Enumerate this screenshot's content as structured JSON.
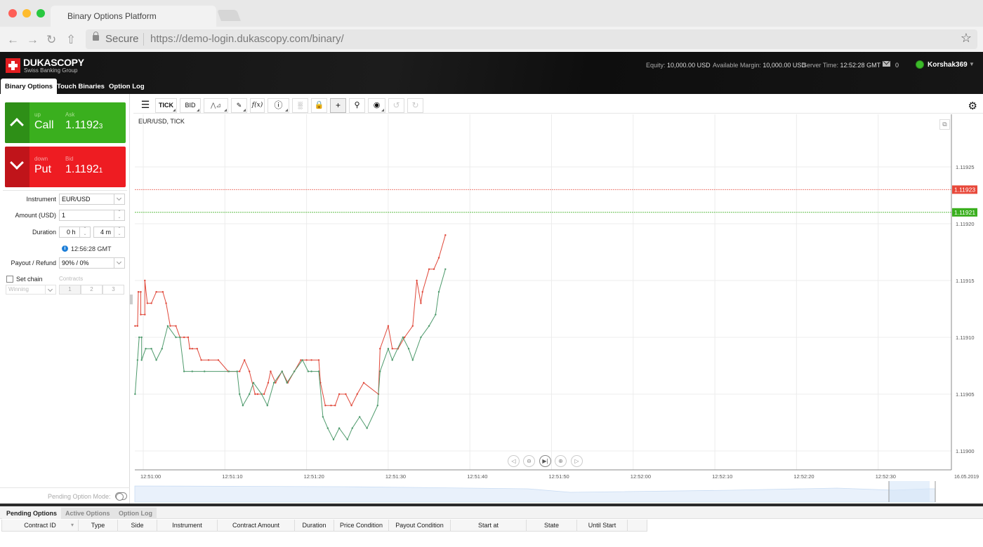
{
  "browser": {
    "tab_title": "Binary Options Platform",
    "secure_label": "Secure",
    "url": "https://demo-login.dukascopy.com/binary/"
  },
  "header": {
    "brand": "DUKASCOPY",
    "brand_sub": "Swiss Banking Group",
    "equity_label": "Equity:",
    "equity_value": "10,000.00 USD",
    "margin_label": "Available Margin:",
    "margin_value": "10,000.00 USD",
    "server_time_label": "Server Time:",
    "server_time_value": "12:52:28 GMT",
    "messages_count": "0",
    "username": "Korshak369",
    "tabs": [
      {
        "label": "Binary Options",
        "active": true
      },
      {
        "label": "Touch Binaries",
        "active": false
      },
      {
        "label": "Option Log",
        "active": false
      }
    ]
  },
  "trade": {
    "call": {
      "dir": "up",
      "side": "Call",
      "price_label": "Ask",
      "price_main": "1.1192",
      "price_pip": "3",
      "color": "#3aaf1e",
      "arrow_bg": "#2e8f17"
    },
    "put": {
      "dir": "down",
      "side": "Put",
      "price_label": "Bid",
      "price_main": "1.1192",
      "price_pip": "1",
      "color": "#ee1c22",
      "arrow_bg": "#c0141a"
    },
    "instrument_label": "Instrument",
    "instrument_value": "EUR/USD",
    "amount_label": "Amount (USD)",
    "amount_value": "1",
    "duration_label": "Duration",
    "duration_hours": "0 h",
    "duration_minutes": "4 m",
    "expiry_time": "12:56:28 GMT",
    "payout_label": "Payout / Refund",
    "payout_value": "90% / 0%",
    "set_chain_label": "Set chain",
    "contracts_label": "Contracts",
    "chain_condition": "Winning",
    "contracts_options": [
      "1",
      "2",
      "3"
    ],
    "pending_mode_label": "Pending Option Mode:"
  },
  "chart_toolbar": {
    "period": "TICK",
    "price_side": "BID",
    "fx_label": "f(x)"
  },
  "chart_data": {
    "type": "line",
    "title": "EUR/USD, TICK",
    "xlabel": "",
    "ylabel": "",
    "date_label": "16.05.2019",
    "x_unit": "seconds after 12:51:00",
    "x_ticks": [
      "12:51:00",
      "12:51:10",
      "12:51:20",
      "12:51:30",
      "12:51:40",
      "12:51:50",
      "12:52:00",
      "12:52:10",
      "12:52:20",
      "12:52:30"
    ],
    "y_ticks": [
      "1.11900",
      "1.11905",
      "1.11910",
      "1.11915",
      "1.11920",
      "1.11925"
    ],
    "ylim": [
      1.118985,
      1.11927
    ],
    "xlim": [
      -1,
      37
    ],
    "grid": true,
    "current_ask": {
      "value": "1.11923",
      "color": "#e8483a"
    },
    "current_bid": {
      "value": "1.11921",
      "color": "#3aaf1e"
    },
    "series": [
      {
        "name": "Ask",
        "color": "#e0483a",
        "points": [
          [
            -1,
            1.11911
          ],
          [
            -0.7,
            1.11911
          ],
          [
            -0.6,
            1.11914
          ],
          [
            -0.3,
            1.11914
          ],
          [
            -0.3,
            1.11912
          ],
          [
            0.2,
            1.11912
          ],
          [
            0.2,
            1.11915
          ],
          [
            0.5,
            1.11913
          ],
          [
            1,
            1.11913
          ],
          [
            1.6,
            1.11914
          ],
          [
            2.4,
            1.11914
          ],
          [
            2.8,
            1.11913
          ],
          [
            3.3,
            1.11911
          ],
          [
            4.0,
            1.11911
          ],
          [
            4.5,
            1.1191
          ],
          [
            5.0,
            1.1191
          ],
          [
            5.5,
            1.1191
          ],
          [
            5.7,
            1.11909
          ],
          [
            6.0,
            1.11909
          ],
          [
            6.6,
            1.11909
          ],
          [
            7.1,
            1.11908
          ],
          [
            8.0,
            1.11908
          ],
          [
            9.2,
            1.11908
          ],
          [
            10.4,
            1.11907
          ],
          [
            11.8,
            1.11907
          ],
          [
            12.4,
            1.11908
          ],
          [
            13.0,
            1.11907
          ],
          [
            13.7,
            1.11905
          ],
          [
            14.0,
            1.11905
          ],
          [
            14.8,
            1.11905
          ],
          [
            15.3,
            1.11906
          ],
          [
            15.6,
            1.11907
          ],
          [
            16.2,
            1.11906
          ],
          [
            17.0,
            1.11907
          ],
          [
            17.7,
            1.11906
          ],
          [
            18.5,
            1.11907
          ],
          [
            19.3,
            1.11908
          ],
          [
            20.0,
            1.11908
          ],
          [
            20.6,
            1.11908
          ],
          [
            21.5,
            1.11908
          ],
          [
            21.7,
            1.11906
          ],
          [
            22.3,
            1.11904
          ],
          [
            23.0,
            1.11904
          ],
          [
            23.5,
            1.11904
          ],
          [
            24.0,
            1.11905
          ],
          [
            24.8,
            1.11905
          ],
          [
            25.5,
            1.11904
          ],
          [
            26.2,
            1.11905
          ],
          [
            27.0,
            1.11906
          ],
          [
            28.8,
            1.11905
          ],
          [
            29.0,
            1.11909
          ],
          [
            30.0,
            1.11911
          ],
          [
            30.5,
            1.11909
          ],
          [
            31.2,
            1.11909
          ],
          [
            32.0,
            1.1191
          ],
          [
            33.0,
            1.11911
          ],
          [
            33.5,
            1.11915
          ],
          [
            34.0,
            1.11913
          ],
          [
            34.2,
            1.11914
          ],
          [
            35.0,
            1.11916
          ],
          [
            35.6,
            1.11916
          ],
          [
            36.2,
            1.11917
          ],
          [
            37.0,
            1.11919
          ]
        ]
      },
      {
        "name": "Bid",
        "color": "#4e9a6c",
        "points": [
          [
            -1,
            1.11905
          ],
          [
            -0.7,
            1.11908
          ],
          [
            -0.5,
            1.1191
          ],
          [
            -0.2,
            1.1191
          ],
          [
            -0.2,
            1.11908
          ],
          [
            0.3,
            1.11909
          ],
          [
            1.0,
            1.11909
          ],
          [
            1.6,
            1.11908
          ],
          [
            2.3,
            1.11909
          ],
          [
            3.0,
            1.11911
          ],
          [
            4.0,
            1.1191
          ],
          [
            4.5,
            1.1191
          ],
          [
            5.0,
            1.11907
          ],
          [
            6.0,
            1.11907
          ],
          [
            7.5,
            1.11907
          ],
          [
            10.5,
            1.11907
          ],
          [
            11.5,
            1.11907
          ],
          [
            11.8,
            1.11905
          ],
          [
            12.2,
            1.11904
          ],
          [
            13.0,
            1.11905
          ],
          [
            13.5,
            1.11906
          ],
          [
            14.5,
            1.11905
          ],
          [
            15.2,
            1.11904
          ],
          [
            16.0,
            1.11906
          ],
          [
            17.0,
            1.11907
          ],
          [
            17.6,
            1.11906
          ],
          [
            18.5,
            1.11907
          ],
          [
            19.5,
            1.11908
          ],
          [
            20.2,
            1.11907
          ],
          [
            20.6,
            1.11907
          ],
          [
            21.5,
            1.11907
          ],
          [
            22.0,
            1.11903
          ],
          [
            22.6,
            1.11902
          ],
          [
            23.3,
            1.11901
          ],
          [
            24.0,
            1.11902
          ],
          [
            25.0,
            1.11901
          ],
          [
            25.6,
            1.11902
          ],
          [
            26.5,
            1.11903
          ],
          [
            27.4,
            1.11902
          ],
          [
            28.7,
            1.11904
          ],
          [
            29.0,
            1.11907
          ],
          [
            30.0,
            1.11909
          ],
          [
            30.5,
            1.11908
          ],
          [
            31.8,
            1.1191
          ],
          [
            32.5,
            1.11909
          ],
          [
            33.0,
            1.11908
          ],
          [
            34.0,
            1.1191
          ],
          [
            35.0,
            1.11911
          ],
          [
            35.8,
            1.11912
          ],
          [
            36.2,
            1.11914
          ],
          [
            37.0,
            1.11916
          ]
        ]
      }
    ]
  },
  "bottom": {
    "tabs": [
      {
        "label": "Pending Options",
        "active": true
      },
      {
        "label": "Active Options",
        "active": false
      },
      {
        "label": "Option Log",
        "active": false
      }
    ],
    "columns": [
      "Contract ID",
      "Type",
      "Side",
      "Instrument",
      "Contract Amount",
      "Duration",
      "Price Condition",
      "Payout Condition",
      "Start at",
      "State",
      "Until Start",
      ""
    ],
    "rows": []
  }
}
